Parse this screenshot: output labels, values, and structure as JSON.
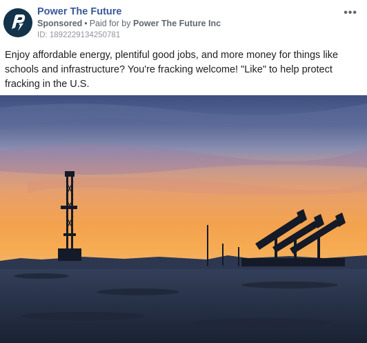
{
  "post": {
    "page_name": "Power The Future",
    "sponsored_label": "Sponsored",
    "separator": "•",
    "paid_for_prefix": "Paid for by",
    "paid_for_name": "Power The Future Inc",
    "ad_id": "ID: 1892229134250781",
    "more_label": "•••",
    "text": "Enjoy affordable energy, plentiful good jobs, and more money for things like schools and infrastructure? You're fracking welcome! \"Like\" to help protect fracking in the U.S."
  },
  "icons": {
    "avatar": "power-the-future-logo",
    "more": "more-options-icon"
  },
  "colors": {
    "link": "#385898",
    "avatar_bg": "#13334a",
    "meta_text": "#606770"
  }
}
